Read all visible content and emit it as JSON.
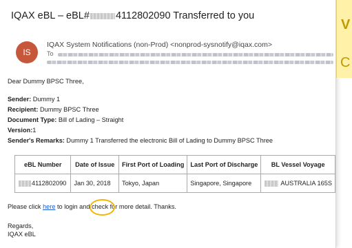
{
  "email": {
    "subject_prefix": "IQAX eBL – eBL#",
    "subject_suffix": "4112802090 Transferred to you",
    "avatar_initials": "IS",
    "from": "IQAX System Notifications (non-Prod) <nonprod-sysnotify@iqax.com>",
    "to_label": "To",
    "greeting": "Dear Dummy BPSC Three,",
    "sender_label": "Sender:",
    "sender_value": " Dummy 1",
    "recipient_label": "Recipient:",
    "recipient_value": " Dummy BPSC Three",
    "doctype_label": "Document Type:",
    "doctype_value": " Bill of Lading – Straight",
    "version_label": "Version:",
    "version_value": "1",
    "remarks_label": "Sender's Remarks:",
    "remarks_value": " Dummy 1 Transferred the electronic Bill of Lading to Dummy BPSC Three",
    "table": {
      "headers": [
        "eBL Number",
        "Date of Issue",
        "First Port of Loading",
        "Last Port of Discharge",
        "BL Vessel Voyage"
      ],
      "row": [
        "4112802090",
        "Jan 30, 2018",
        "Tokyo, Japan",
        "Singapore, Singapore",
        "AUSTRALIA 165S"
      ]
    },
    "click_pre": "Please click ",
    "click_link": "here",
    "click_post": " to login and check for more detail. Thanks.",
    "regards": "Regards,",
    "signature": "IQAX eBL"
  },
  "side_card": {
    "letter_top": "V",
    "letter_bottom": "C"
  },
  "colors": {
    "avatar": "#c7573a",
    "highlight_circle": "#f4b400",
    "side_card": "#fff1a8",
    "link": "#1a5bd6"
  }
}
